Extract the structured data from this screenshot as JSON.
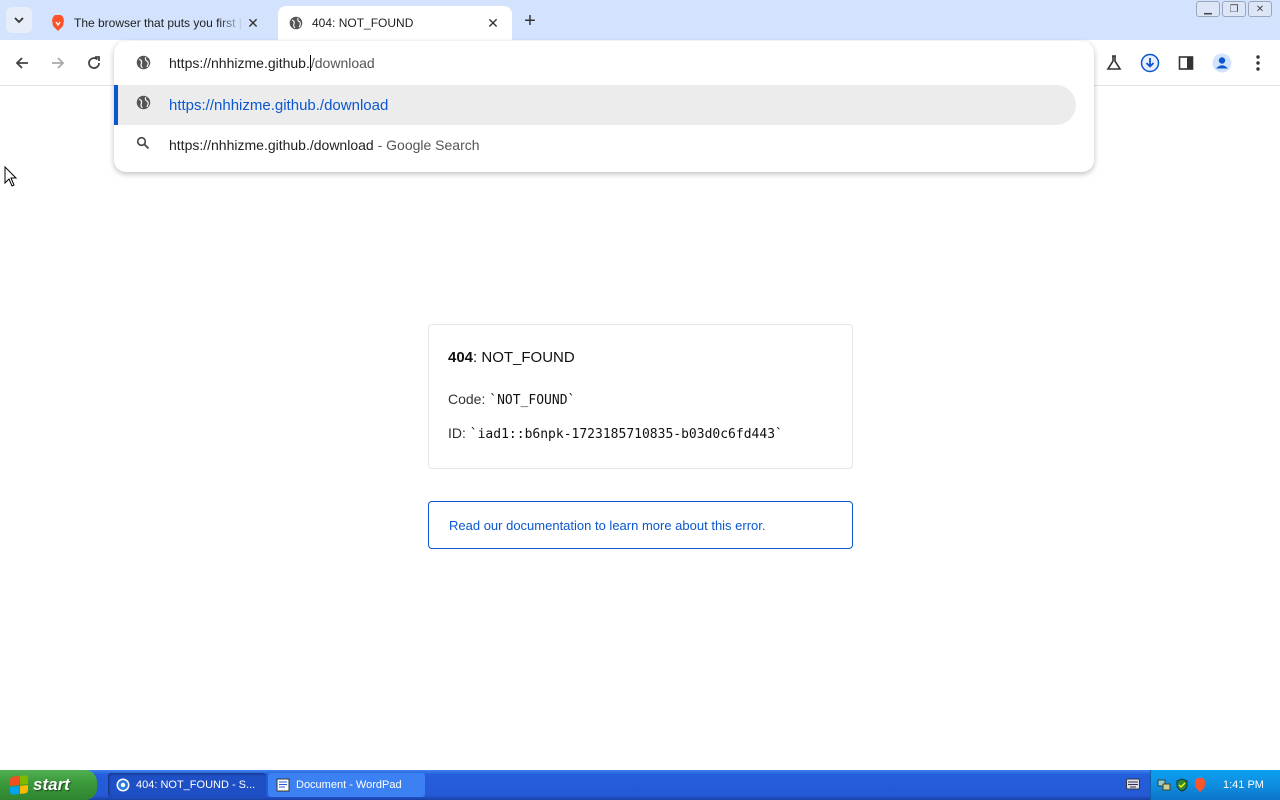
{
  "tabs": [
    {
      "title": "The browser that puts you first | Brave",
      "icon": "brave-lion-icon",
      "active": false
    },
    {
      "title": "404: NOT_FOUND",
      "icon": "globe-icon",
      "active": true
    }
  ],
  "omnibox": {
    "typed_prefix": "https://nhhizme.github.",
    "typed_rest": "/download",
    "suggestions": [
      {
        "text": "https://nhhizme.github./download",
        "suffix": "",
        "icon": "globe-icon"
      },
      {
        "text": "https://nhhizme.github./download",
        "suffix": " - Google Search",
        "icon": "search-icon"
      }
    ]
  },
  "page": {
    "error_code_bold": "404",
    "error_title_rest": ": NOT_FOUND",
    "code_label": "Code: ",
    "code_value": "`NOT_FOUND`",
    "id_label": "ID: ",
    "id_value": "`iad1::b6npk-1723185710835-b03d0c6fd443`",
    "doc_link": "Read our documentation to learn more about this error."
  },
  "taskbar": {
    "start_label": "start",
    "tasks": [
      {
        "label": "404: NOT_FOUND - S...",
        "icon": "browser-icon",
        "active": true
      },
      {
        "label": "Document - WordPad",
        "icon": "wordpad-icon",
        "active": false
      }
    ],
    "clock": "1:41 PM"
  },
  "colors": {
    "accent": "#0b57d0",
    "tabstrip": "#d3e3fd",
    "taskbar": "#245edb",
    "start": "#3c9a3c"
  }
}
